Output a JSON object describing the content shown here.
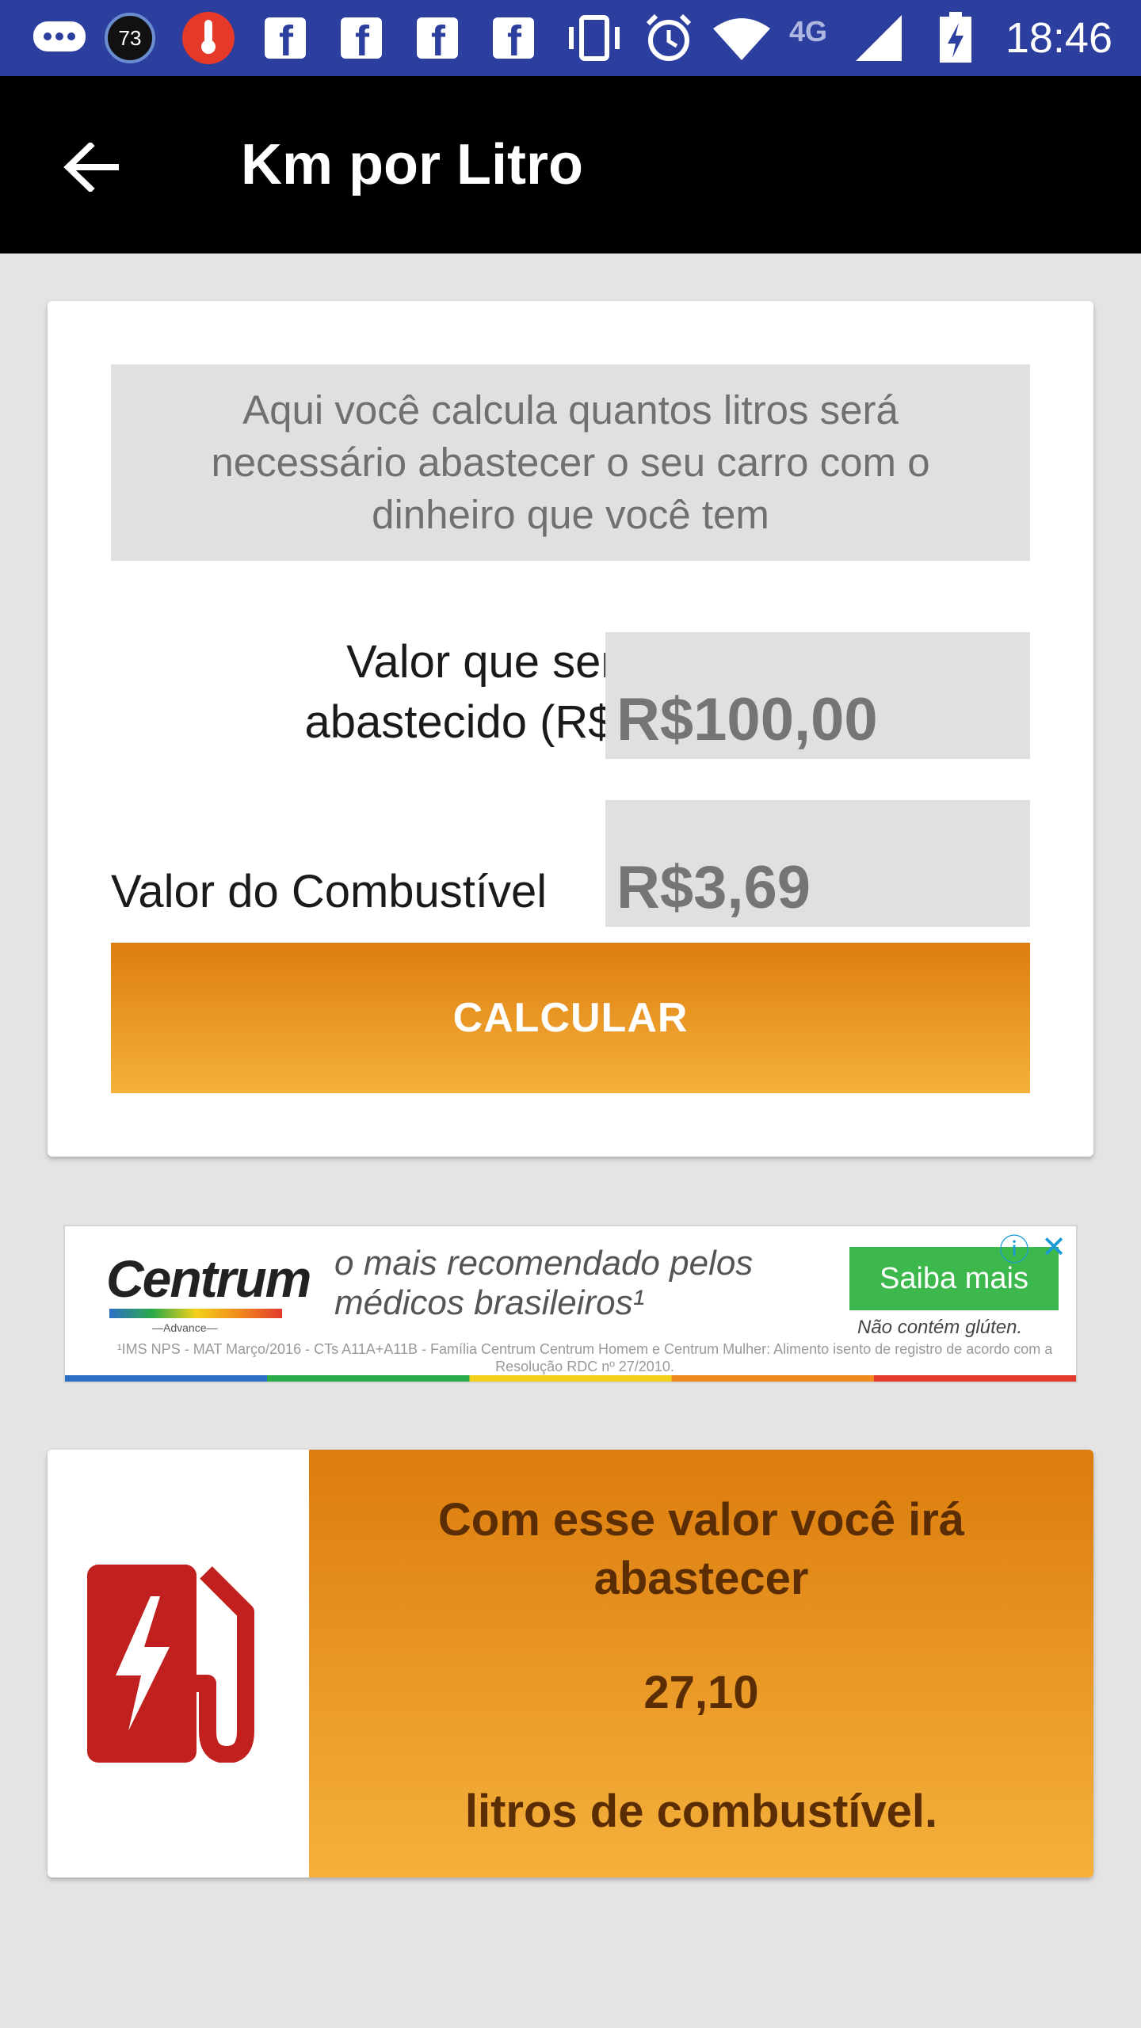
{
  "status_bar": {
    "notification_badge": "73",
    "network": "4G",
    "time": "18:46",
    "icons": [
      "chat-bubble-icon",
      "badge-73-icon",
      "thermometer-icon",
      "facebook-icon",
      "facebook-icon",
      "facebook-icon",
      "facebook-icon",
      "vibrate-icon",
      "alarm-icon",
      "wifi-icon",
      "signal-icon",
      "battery-icon"
    ]
  },
  "toolbar": {
    "title": "Km por Litro",
    "back_icon": "arrow-left-icon"
  },
  "calculator": {
    "description": "Aqui você calcula quantos litros será necessário abastecer o seu carro com o dinheiro que você tem",
    "amount_label": "Valor que será abastecido (R$):",
    "amount_value": "R$100,00",
    "fuel_label": "Valor do Combustível",
    "fuel_value": "R$3,69",
    "button_label": "CALCULAR"
  },
  "ad": {
    "brand": "Centrum",
    "brand_sub": "—Advance—",
    "headline": "o mais recomendado pelos médicos brasileiros¹",
    "cta": "Saiba mais",
    "note": "Não contém glúten.",
    "fine_print": "¹IMS NPS - MAT Março/2016 - CTs A11A+A11B - Família Centrum Centrum Homem e Centrum Mulher: Alimento isento de registro de acordo com a Resolução RDC nº 27/2010.",
    "info_glyph": "ⓘ",
    "close_glyph": "✕"
  },
  "result": {
    "line1": "Com esse valor você irá abastecer",
    "value": "27,10",
    "line3": "litros de combustível.",
    "icon": "fuel-pump-icon"
  },
  "colors": {
    "status_bar": "#2c3e9e",
    "toolbar": "#000000",
    "accent_orange": "#dd7d10",
    "result_text": "#5a2d04",
    "fuel_icon": "#c0201e"
  }
}
